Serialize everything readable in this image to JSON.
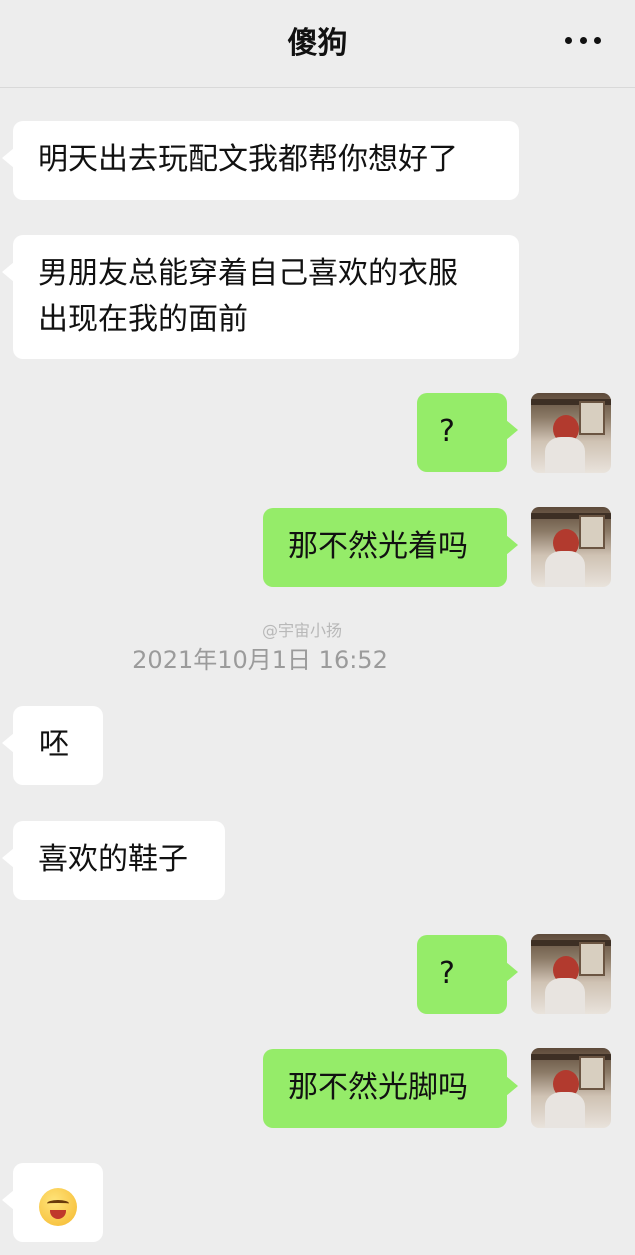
{
  "header": {
    "title": "傻狗",
    "more_icon": "more-dots-icon"
  },
  "messages": [
    {
      "side": "left",
      "text": "明天出去玩配文我都帮你想好了"
    },
    {
      "side": "left",
      "text": "男朋友总能穿着自己喜欢的衣服出现在我的面前",
      "line1": "男朋友总能穿着自己喜欢的衣服",
      "line2": "出现在我的面前"
    },
    {
      "side": "right",
      "text": "?"
    },
    {
      "side": "right",
      "text": "那不然光着吗"
    },
    {
      "side": "left",
      "text": "呸"
    },
    {
      "side": "left",
      "text": "喜欢的鞋子"
    },
    {
      "side": "right",
      "text": "?"
    },
    {
      "side": "right",
      "text": "那不然光脚吗"
    },
    {
      "side": "left",
      "emoji": "grimace-laugh-emoji-icon"
    }
  ],
  "timestamp": "2021年10月1日 16:52",
  "watermark": "@宇宙小扬"
}
